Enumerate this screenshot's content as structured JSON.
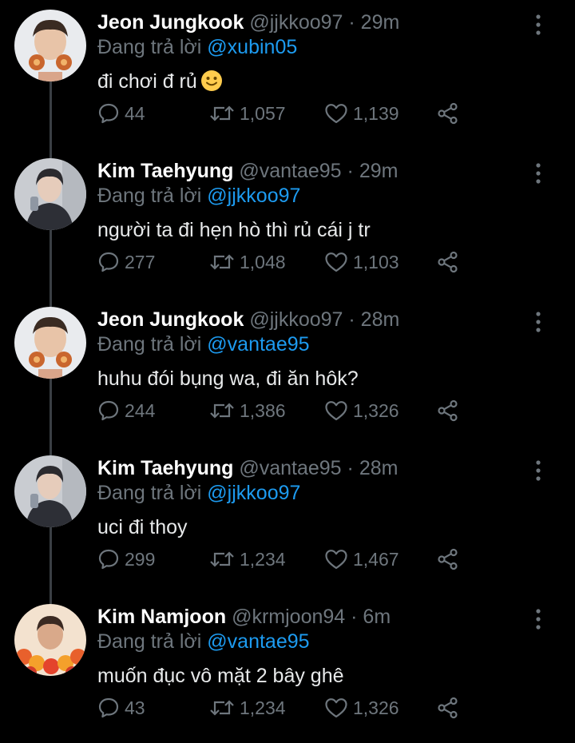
{
  "tweets": [
    {
      "name": "Jeon Jungkook",
      "handle": "@jjkkoo97",
      "time": "29m",
      "replying_prefix": "Đang trả lời",
      "replying_to": "@xubin05",
      "text": "đi chơi đ rủ",
      "emoji": "slightly-smiling-face",
      "replies": "44",
      "retweets": "1,057",
      "likes": "1,139",
      "avatar": "avatar-jungkook"
    },
    {
      "name": "Kim Taehyung",
      "handle": "@vantae95",
      "time": "29m",
      "replying_prefix": "Đang trả lời",
      "replying_to": "@jjkkoo97",
      "text": "người ta đi hẹn hò thì rủ cái j tr",
      "replies": "277",
      "retweets": "1,048",
      "likes": "1,103",
      "avatar": "avatar-taehyung"
    },
    {
      "name": "Jeon Jungkook",
      "handle": "@jjkkoo97",
      "time": "28m",
      "replying_prefix": "Đang trả lời",
      "replying_to": "@vantae95",
      "text": "huhu đói bụng wa, đi ăn hôk?",
      "replies": "244",
      "retweets": "1,386",
      "likes": "1,326",
      "avatar": "avatar-jungkook"
    },
    {
      "name": "Kim Taehyung",
      "handle": "@vantae95",
      "time": "28m",
      "replying_prefix": "Đang trả lời",
      "replying_to": "@jjkkoo97",
      "text": "uci đi thoy",
      "replies": "299",
      "retweets": "1,234",
      "likes": "1,467",
      "avatar": "avatar-taehyung"
    },
    {
      "name": "Kim Namjoon",
      "handle": "@krmjoon94",
      "time": "6m",
      "replying_prefix": "Đang trả lời",
      "replying_to": "@vantae95",
      "text": "muốn đục vô mặt 2 bây ghê",
      "replies": "43",
      "retweets": "1,234",
      "likes": "1,326",
      "avatar": "avatar-namjoon"
    }
  ],
  "separator": "·",
  "icons": {
    "reply": "reply-icon",
    "retweet": "retweet-icon",
    "like": "heart-icon",
    "share": "share-icon",
    "more": "more-vertical-icon"
  },
  "colors": {
    "background": "#000000",
    "name": "#ffffff",
    "secondary": "#6e767d",
    "mention": "#1d9bf0",
    "thread_line": "#3a3f44"
  }
}
